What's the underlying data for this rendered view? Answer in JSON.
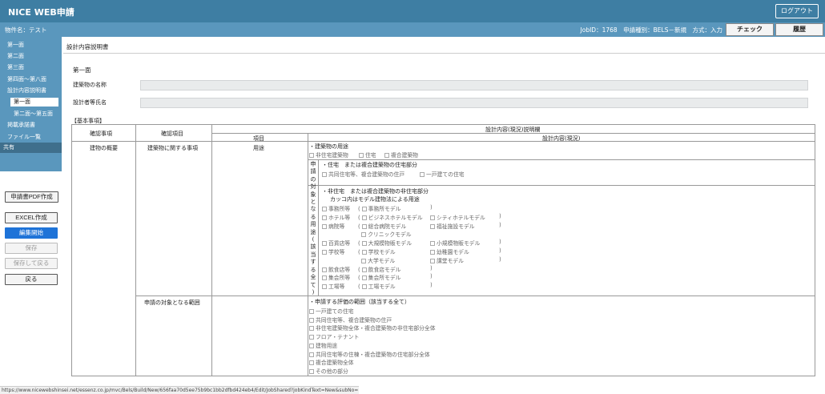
{
  "header": {
    "app_title": "NICE WEB申請",
    "logout_label": "ログアウト"
  },
  "subheader": {
    "property_name": "物件名：テスト",
    "info": "JobID：1768　申請種別：BELS－新規　方式：入力",
    "check_label": "チェック",
    "history_label": "履歴"
  },
  "sidebar": {
    "items": [
      "第一面",
      "第二面",
      "第三面",
      "第四面～第八面",
      "設計内容説明書",
      "第一面",
      "第二面～第五面",
      "掲載承諾書",
      "ファイル一覧",
      "共有"
    ],
    "buttons": {
      "pdf": "申請書PDF作成",
      "excel": "EXCEL作成",
      "edit_start": "編集開始",
      "save": "保存",
      "save_return": "保存して戻る",
      "back": "戻る"
    }
  },
  "main": {
    "title": "設計内容説明書",
    "section": "第一面",
    "fields": [
      {
        "label": "建築物の名称",
        "value": ""
      },
      {
        "label": "設計者等氏名",
        "value": ""
      }
    ],
    "basic_label": "【基本事項】",
    "table": {
      "h_kakunin_jiko": "確認事項",
      "h_kakunin_komoku": "確認項目",
      "h_setsumei": "設計内容(現況)説明欄",
      "h_komoku": "項目",
      "h_naiyo": "設計内容(現況)",
      "r_category": "建物の概要",
      "r_item1": "建築物に関する事項",
      "r_sub1": "用途",
      "r_item2": "申請の対象となる範囲",
      "vertical_text": "申請の対象となる用途(該当する全て)",
      "use_title": "・建築物の用途",
      "use_opts": [
        "非住宅建築物",
        "住宅",
        "複合建築物"
      ],
      "res_title": "・住宅　または複合建築物の住宅部分",
      "res_opts": [
        "共同住宅等、複合建築物の住戸",
        "一戸建ての住宅"
      ],
      "nonres_title": "・非住宅　または複合建築物の非住宅部分",
      "nonres_note": "カッコ内はモデル建物法による用途",
      "nonres_rows": [
        {
          "c1": "事務所等",
          "c2": [
            "事務所モデル"
          ],
          "c3": []
        },
        {
          "c1": "ホテル等",
          "c2": [
            "ビジネスホテルモデル"
          ],
          "c3": [
            "シティホテルモデル"
          ]
        },
        {
          "c1": "病院等",
          "c2": [
            "総合病院モデル"
          ],
          "c3": [
            "福祉施設モデル"
          ]
        },
        {
          "c1": "",
          "c2": [
            "クリニックモデル"
          ],
          "c3": []
        },
        {
          "c1": "百貨店等",
          "c2": [
            "大規模物販モデル"
          ],
          "c3": [
            "小規模物販モデル"
          ]
        },
        {
          "c1": "学校等",
          "c2": [
            "学校モデル"
          ],
          "c3": [
            "幼稚園モデル"
          ]
        },
        {
          "c1": "",
          "c2": [
            "大学モデル"
          ],
          "c3": [
            "講堂モデル"
          ]
        },
        {
          "c1": "飲食店等",
          "c2": [
            "飲食店モデル"
          ],
          "c3": []
        },
        {
          "c1": "集会所等",
          "c2": [
            "集会所モデル"
          ],
          "c3": []
        },
        {
          "c1": "工場等",
          "c2": [
            "工場モデル"
          ],
          "c3": []
        }
      ],
      "eval_title": "・申請する評価の範囲（該当する全て）",
      "eval_opts": [
        "一戸建ての住宅",
        "共同住宅等、複合建築物の住戸",
        "非住宅建築物全体・複合建築物の非住宅部分全体",
        "フロア・テナント",
        "建物用途",
        "共同住宅等の住棟・複合建築物の住宅部分全体",
        "複合建築物全体",
        "その他の部分"
      ]
    }
  },
  "status_url": "https://www.nicewebshinsei.net/essenz.co.jp/mvc/Bels/Build/New/656faa70d5ee75b9bc1bb2dfbd424eb4/Edit/JobShared?jobKindText=New&subNo=1"
}
